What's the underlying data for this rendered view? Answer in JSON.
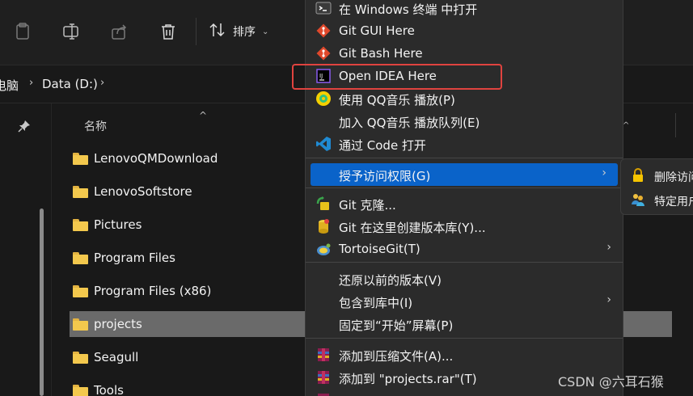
{
  "toolbar": {
    "icons": [
      "clipboard-icon",
      "rename-icon",
      "share-icon",
      "delete-icon"
    ],
    "sort_label": "排序",
    "sort_chevron": "⌄"
  },
  "addressbar": {
    "crumbs": [
      "电脑",
      "Data (D:)"
    ],
    "separator": "›"
  },
  "filelist": {
    "column_name": "名称",
    "sort_arrow": "^",
    "rows": [
      {
        "name": "LenovoQMDownload",
        "selected": false
      },
      {
        "name": "LenovoSoftstore",
        "selected": false
      },
      {
        "name": "Pictures",
        "selected": false
      },
      {
        "name": "Program Files",
        "selected": false
      },
      {
        "name": "Program Files (x86)",
        "selected": false
      },
      {
        "name": "projects",
        "selected": true
      },
      {
        "name": "Seagull",
        "selected": false
      },
      {
        "name": "Tools",
        "selected": false
      }
    ]
  },
  "context_menu": {
    "items": [
      {
        "label": "在 Windows 终端 中打开",
        "icon": "terminal-icon"
      },
      {
        "label": "Git GUI Here",
        "icon": "git-icon"
      },
      {
        "label": "Git Bash Here",
        "icon": "git-icon"
      },
      {
        "label": "Open IDEA Here",
        "icon": "intellij-icon"
      },
      {
        "label": "使用 QQ音乐 播放(P)",
        "icon": "qqmusic-icon"
      },
      {
        "label": "加入 QQ音乐 播放队列(E)",
        "icon": ""
      },
      {
        "label": "通过 Code 打开",
        "icon": "vscode-icon"
      },
      {
        "label": "授予访问权限(G)",
        "icon": "",
        "submenu": true
      },
      {
        "label": "Git 克隆...",
        "icon": "tortoisegit-clone-icon"
      },
      {
        "label": "Git 在这里创建版本库(Y)...",
        "icon": "tortoisegit-repo-icon"
      },
      {
        "label": "TortoiseGit(T)",
        "icon": "tortoisegit-icon",
        "submenu": true
      },
      {
        "label": "还原以前的版本(V)",
        "icon": ""
      },
      {
        "label": "包含到库中(I)",
        "icon": "",
        "submenu": true
      },
      {
        "label": "固定到“开始”屏幕(P)",
        "icon": ""
      },
      {
        "label": "添加到压缩文件(A)...",
        "icon": "winrar-icon"
      },
      {
        "label": "添加到 \"projects.rar\"(T)",
        "icon": "winrar-icon"
      }
    ],
    "submenu_arrow": "›",
    "highlight_color": "#0a63c9",
    "callout_color": "#e0433f"
  },
  "submenu": {
    "items": [
      {
        "label": "删除访问",
        "icon": "lock-icon"
      },
      {
        "label": "特定用户",
        "icon": "users-icon"
      }
    ]
  },
  "watermark": "CSDN @六耳石猴"
}
